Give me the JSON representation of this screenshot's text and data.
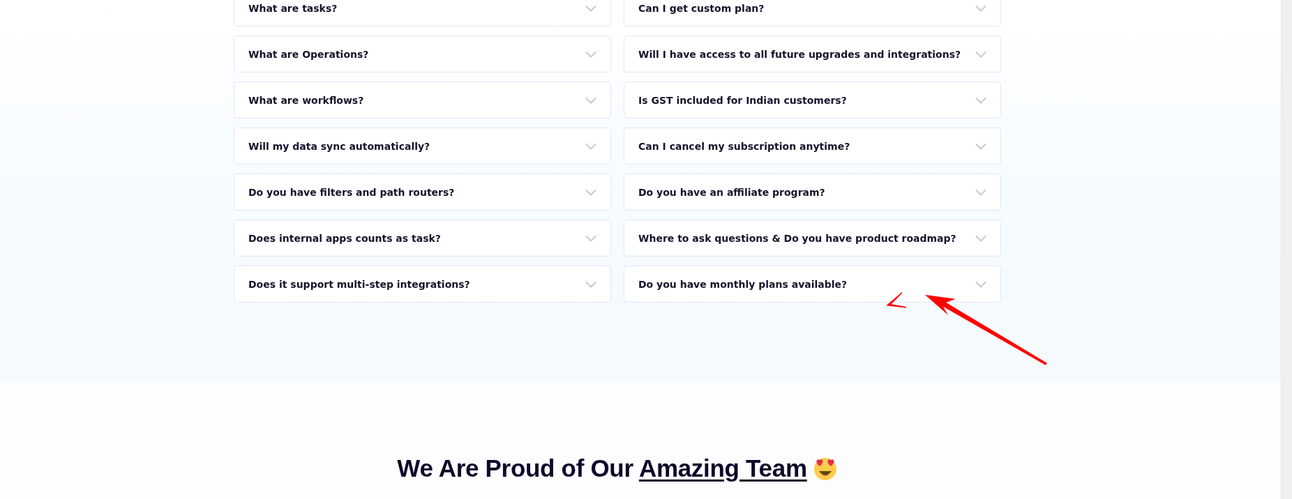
{
  "faq": {
    "columns": [
      {
        "items": [
          {
            "question": "What are tasks?",
            "expanded": false
          },
          {
            "question": "What are Operations?",
            "expanded": false
          },
          {
            "question": "What are workflows?",
            "expanded": false
          },
          {
            "question": "Will my data sync automatically?",
            "expanded": false
          },
          {
            "question": "Do you have filters and path routers?",
            "expanded": false
          },
          {
            "question": "Does internal apps counts as task?",
            "expanded": false
          },
          {
            "question": "Does it support multi-step integrations?",
            "expanded": false
          }
        ]
      },
      {
        "items": [
          {
            "question": "Can I get custom plan?",
            "expanded": false
          },
          {
            "question": "Will I have access to all future upgrades and integrations?",
            "expanded": false
          },
          {
            "question": "Is GST included for Indian customers?",
            "expanded": false
          },
          {
            "question": "Can I cancel my subscription anytime?",
            "expanded": false
          },
          {
            "question": "Do you have an affiliate program?",
            "expanded": false
          },
          {
            "question": "Where to ask questions & Do you have product roadmap?",
            "expanded": false
          },
          {
            "question": "Do you have monthly plans available?",
            "expanded": false
          }
        ]
      }
    ]
  },
  "team": {
    "heading": "We Are Proud of Our",
    "heading_link": "Amazing Team"
  }
}
